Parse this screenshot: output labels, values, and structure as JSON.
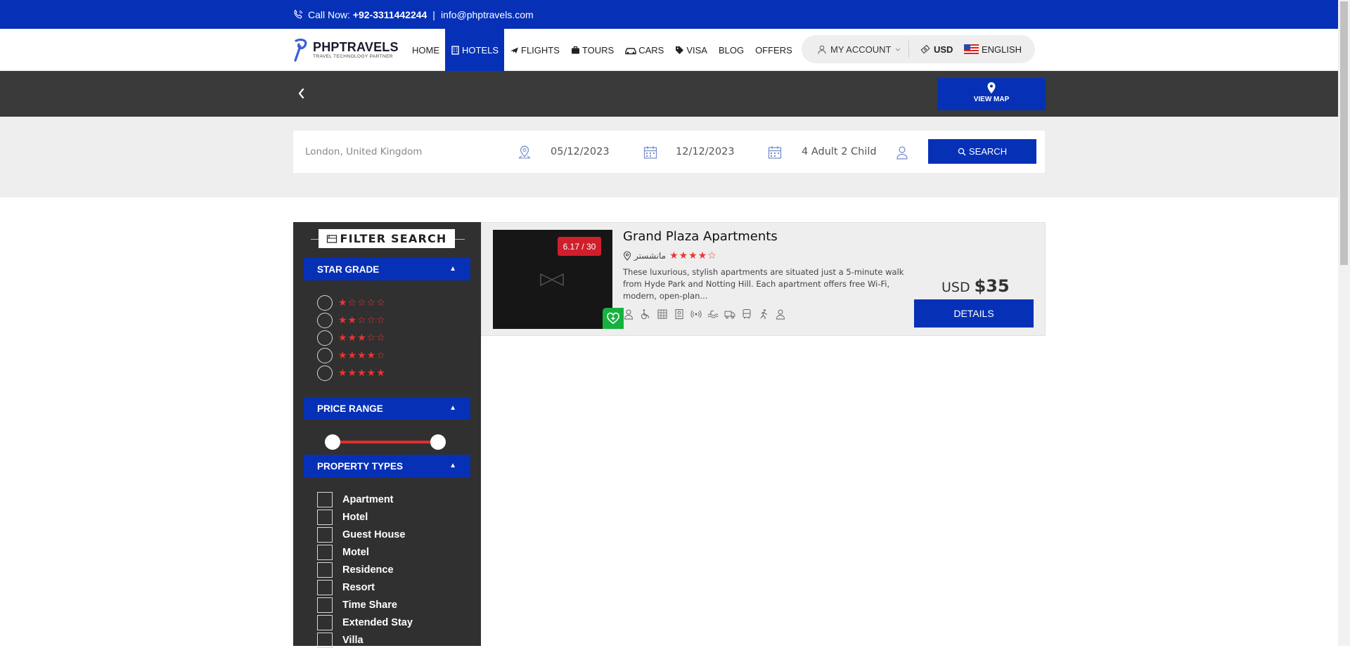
{
  "topbar": {
    "call_label": "Call Now:",
    "phone": "+92-3311442244",
    "separator": "|",
    "email": "info@phptravels.com"
  },
  "brand": {
    "name": "PHPTRAVELS",
    "tagline": "TRAVEL TECHNOLOGY PARTNER"
  },
  "nav": {
    "home": "HOME",
    "hotels": "HOTELS",
    "flights": "FLIGHTS",
    "tours": "TOURS",
    "cars": "CARS",
    "visa": "VISA",
    "blog": "BLOG",
    "offers": "OFFERS",
    "account": "MY ACCOUNT",
    "currency": "USD",
    "language": "ENGLISH"
  },
  "map_button": "VIEW MAP",
  "search": {
    "location_placeholder": "London, United Kingdom",
    "checkin": "05/12/2023",
    "checkout": "12/12/2023",
    "guests": "4 Adult 2 Child",
    "button": "SEARCH"
  },
  "filters": {
    "title": "FILTER SEARCH",
    "star_grade": "STAR GRADE",
    "star_options": [
      {
        "stars": 1,
        "glyphs": "★☆☆☆☆"
      },
      {
        "stars": 2,
        "glyphs": "★★☆☆☆"
      },
      {
        "stars": 3,
        "glyphs": "★★★☆☆"
      },
      {
        "stars": 4,
        "glyphs": "★★★★☆"
      },
      {
        "stars": 5,
        "glyphs": "★★★★★"
      }
    ],
    "price_range": "PRICE RANGE",
    "price_slider": {
      "min_position": 0,
      "max_position": 1
    },
    "property_types": "PROPERTY TYPES",
    "types": [
      "Apartment",
      "Hotel",
      "Guest House",
      "Motel",
      "Residence",
      "Resort",
      "Time Share",
      "Extended Stay",
      "Villa"
    ]
  },
  "results": [
    {
      "name": "Grand Plaza Apartments",
      "location": "مانشستر",
      "stars": 4,
      "star_glyphs": "★★★★☆",
      "score": "6.17 / 30",
      "description": "These luxurious, stylish apartments are situated just a 5-minute walk from Hyde Park and Notting Hill. Each apartment offers free Wi-Fi, modern, open-plan...",
      "currency": "USD",
      "price": "$35",
      "button": "DETAILS",
      "amenities": [
        "person-icon",
        "wheelchair-icon",
        "building-icon",
        "hotel-icon",
        "wifi-icon",
        "pool-icon",
        "truck-icon",
        "bus-icon",
        "running-icon",
        "user-icon"
      ]
    }
  ],
  "colors": {
    "primary": "#0631b7",
    "dark": "#303030",
    "accent_red": "#ee3333",
    "badge_red": "#d11e2b",
    "green": "#17b23e"
  }
}
